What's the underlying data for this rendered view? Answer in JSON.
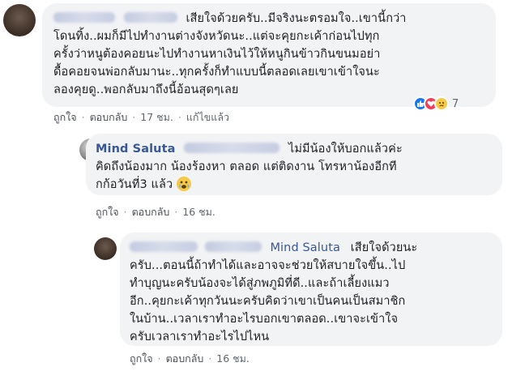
{
  "comments": [
    {
      "author_name": "",
      "text_lines": [
        "เสียใจด้วยครับ..มีจริงนะตรอมใจ..เขานี้กว่า",
        "โดนทิ้ง..ผมก็มีไปทำงานต่างจังหวัดนะ..แต่จะคุยกะเค้าก่อนไปทุก",
        "ครั้งว่าหนูต้องคอยนะไปทำงานหาเงินไว้ให้หนูกินข้าวกินขนมอย่า",
        "ดื้อคอยจนพ่อกลับมานะ..ทุกครั้งก็ทำแบบนี้ตลอดเลยเขาเข้าใจนะ",
        "ลองคุยดู..พอกลับมาถึงนี้อ้อนสุดๆเลย"
      ],
      "actions": {
        "like": "ถูกใจ",
        "reply": "ตอบกลับ",
        "time": "17 ชม.",
        "edited": "แก้ไขแล้ว"
      },
      "reaction_count": "7"
    },
    {
      "author_name": "Mind Saluta",
      "text_lines": [
        "ไม่มีน้องให้บอกแล้วค่ะ",
        "คิดถึงน้องมาก น้องร้องหา ตลอด แต่ติดงาน โทรหาน้องอีกที",
        "กก้อวันที่3 แล้ว"
      ],
      "actions": {
        "like": "ถูกใจ",
        "reply": "ตอบกลับ",
        "time": "16 ชม."
      }
    },
    {
      "mention_name": "Mind Saluta",
      "text_lines": [
        "เสียใจด้วยนะ",
        "ครับ...ตอนนี้ถ้าทำได้และอาจจะช่วยให้สบายใจขึ้น..ไป",
        "ทำบุญนะครับน้องจะได้สู่ภพภูมิที่ดี..และถ้าเลี้ยงแมว",
        "อีก..คุยกะเค้าทุกวันนะครับคิดว่าเขาเป็นคนเป็นสมาชิก",
        "ในบ้าน..เวลาเราทำอะไรบอกเขาตลอด..เขาจะเข้าใจ",
        "ครับเวลาเราทำอะไรไปไหน"
      ],
      "actions": {
        "like": "ถูกใจ",
        "reply": "ตอบกลับ",
        "time": "16 ชม."
      }
    }
  ],
  "colors": {
    "bubble_bg": "#f2f3f5",
    "name_blue": "#385898",
    "action_gray": "#606770",
    "like_blue": "#1877f2",
    "love_red": "#f33e58",
    "sad_yellow": "#f7c948"
  }
}
